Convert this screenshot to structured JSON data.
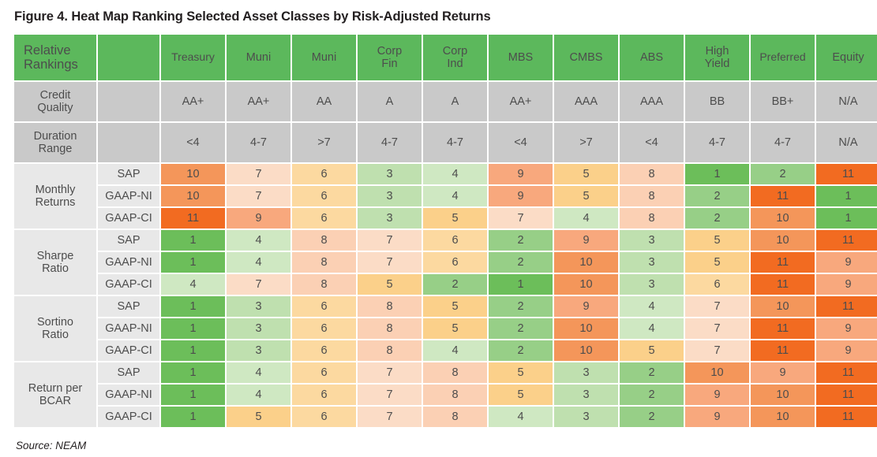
{
  "figure": {
    "title": "Figure 4. Heat Map Ranking Selected Asset Classes by Risk-Adjusted Returns",
    "source": "Source: NEAM"
  },
  "table": {
    "corner_label": "Relative\nRankings",
    "corner_label_line1": "Relative",
    "corner_label_line2": "Rankings",
    "blank_header": "",
    "asset_classes": [
      {
        "label": "Treasury",
        "line1": "Treasury",
        "line2": ""
      },
      {
        "label": "Muni",
        "line1": "Muni",
        "line2": ""
      },
      {
        "label": "Muni",
        "line1": "Muni",
        "line2": ""
      },
      {
        "label": "Corp Fin",
        "line1": "Corp",
        "line2": "Fin"
      },
      {
        "label": "Corp Ind",
        "line1": "Corp",
        "line2": "Ind"
      },
      {
        "label": "MBS",
        "line1": "MBS",
        "line2": ""
      },
      {
        "label": "CMBS",
        "line1": "CMBS",
        "line2": ""
      },
      {
        "label": "ABS",
        "line1": "ABS",
        "line2": ""
      },
      {
        "label": "High Yield",
        "line1": "High",
        "line2": "Yield"
      },
      {
        "label": "Preferred",
        "line1": "Preferred",
        "line2": ""
      },
      {
        "label": "Equity",
        "line1": "Equity",
        "line2": ""
      }
    ],
    "attribute_rows": [
      {
        "label_line1": "Credit",
        "label_line2": "Quality",
        "values": [
          "AA+",
          "AA+",
          "AA",
          "A",
          "A",
          "AA+",
          "AAA",
          "AAA",
          "BB",
          "BB+",
          "N/A"
        ]
      },
      {
        "label_line1": "Duration",
        "label_line2": "Range",
        "values": [
          "<4",
          "4-7",
          ">7",
          "4-7",
          "4-7",
          "<4",
          ">7",
          "<4",
          "4-7",
          "4-7",
          "N/A"
        ]
      }
    ],
    "metric_groups": [
      {
        "label_line1": "Monthly",
        "label_line2": "Returns",
        "rows": [
          {
            "basis": "SAP",
            "values": [
              10,
              7,
              6,
              3,
              4,
              9,
              5,
              8,
              1,
              2,
              11
            ]
          },
          {
            "basis": "GAAP-NI",
            "values": [
              10,
              7,
              6,
              3,
              4,
              9,
              5,
              8,
              2,
              11,
              1
            ]
          },
          {
            "basis": "GAAP-CI",
            "values": [
              11,
              9,
              6,
              3,
              5,
              7,
              4,
              8,
              2,
              10,
              1
            ]
          }
        ]
      },
      {
        "label_line1": "Sharpe",
        "label_line2": "Ratio",
        "rows": [
          {
            "basis": "SAP",
            "values": [
              1,
              4,
              8,
              7,
              6,
              2,
              9,
              3,
              5,
              10,
              11
            ]
          },
          {
            "basis": "GAAP-NI",
            "values": [
              1,
              4,
              8,
              7,
              6,
              2,
              10,
              3,
              5,
              11,
              9
            ]
          },
          {
            "basis": "GAAP-CI",
            "values": [
              4,
              7,
              8,
              5,
              2,
              1,
              10,
              3,
              6,
              11,
              9
            ]
          }
        ]
      },
      {
        "label_line1": "Sortino",
        "label_line2": "Ratio",
        "rows": [
          {
            "basis": "SAP",
            "values": [
              1,
              3,
              6,
              8,
              5,
              2,
              9,
              4,
              7,
              10,
              11
            ]
          },
          {
            "basis": "GAAP-NI",
            "values": [
              1,
              3,
              6,
              8,
              5,
              2,
              10,
              4,
              7,
              11,
              9
            ]
          },
          {
            "basis": "GAAP-CI",
            "values": [
              1,
              3,
              6,
              8,
              4,
              2,
              10,
              5,
              7,
              11,
              9
            ]
          }
        ]
      },
      {
        "label_line1": "Return per",
        "label_line2": "BCAR",
        "rows": [
          {
            "basis": "SAP",
            "values": [
              1,
              4,
              6,
              7,
              8,
              5,
              3,
              2,
              10,
              9,
              11
            ]
          },
          {
            "basis": "GAAP-NI",
            "values": [
              1,
              4,
              6,
              7,
              8,
              5,
              3,
              2,
              9,
              10,
              11
            ]
          },
          {
            "basis": "GAAP-CI",
            "values": [
              1,
              5,
              6,
              7,
              8,
              4,
              3,
              2,
              9,
              10,
              11
            ]
          }
        ]
      }
    ]
  },
  "colors": {
    "header_green": "#5cb85c",
    "attr_gray": "#c9c9c9",
    "label_gray": "#e8e8e8",
    "text_gray": "#4d4d4d",
    "scale": {
      "1": "#6cbe5a",
      "2": "#97cf87",
      "3": "#bfe0af",
      "4": "#cfe8c2",
      "5": "#fbd08a",
      "6": "#fcd9a0",
      "7": "#fbdcc6",
      "8": "#fbd0b4",
      "9": "#f8a87d",
      "10": "#f4965a",
      "11": "#f26b21"
    }
  },
  "chart_data": {
    "type": "heatmap",
    "title": "Figure 4. Heat Map Ranking Selected Asset Classes by Risk-Adjusted Returns",
    "xlabel": "",
    "ylabel": "",
    "legend": "",
    "categories": [
      "Treasury",
      "Muni",
      "Muni",
      "Corp Fin",
      "Corp Ind",
      "MBS",
      "CMBS",
      "ABS",
      "High Yield",
      "Preferred",
      "Equity"
    ],
    "value_range": [
      1,
      11
    ],
    "value_meaning": "Relative rank, 1 = best (green), 11 = worst (orange)",
    "rows": [
      {
        "group": "Monthly Returns",
        "basis": "SAP",
        "values": [
          10,
          7,
          6,
          3,
          4,
          9,
          5,
          8,
          1,
          2,
          11
        ]
      },
      {
        "group": "Monthly Returns",
        "basis": "GAAP-NI",
        "values": [
          10,
          7,
          6,
          3,
          4,
          9,
          5,
          8,
          2,
          11,
          1
        ]
      },
      {
        "group": "Monthly Returns",
        "basis": "GAAP-CI",
        "values": [
          11,
          9,
          6,
          3,
          5,
          7,
          4,
          8,
          2,
          10,
          1
        ]
      },
      {
        "group": "Sharpe Ratio",
        "basis": "SAP",
        "values": [
          1,
          4,
          8,
          7,
          6,
          2,
          9,
          3,
          5,
          10,
          11
        ]
      },
      {
        "group": "Sharpe Ratio",
        "basis": "GAAP-NI",
        "values": [
          1,
          4,
          8,
          7,
          6,
          2,
          10,
          3,
          5,
          11,
          9
        ]
      },
      {
        "group": "Sharpe Ratio",
        "basis": "GAAP-CI",
        "values": [
          4,
          7,
          8,
          5,
          2,
          1,
          10,
          3,
          6,
          11,
          9
        ]
      },
      {
        "group": "Sortino Ratio",
        "basis": "SAP",
        "values": [
          1,
          3,
          6,
          8,
          5,
          2,
          9,
          4,
          7,
          10,
          11
        ]
      },
      {
        "group": "Sortino Ratio",
        "basis": "GAAP-NI",
        "values": [
          1,
          3,
          6,
          8,
          5,
          2,
          10,
          4,
          7,
          11,
          9
        ]
      },
      {
        "group": "Sortino Ratio",
        "basis": "GAAP-CI",
        "values": [
          1,
          3,
          6,
          8,
          4,
          2,
          10,
          5,
          7,
          11,
          9
        ]
      },
      {
        "group": "Return per BCAR",
        "basis": "SAP",
        "values": [
          1,
          4,
          6,
          7,
          8,
          5,
          3,
          2,
          10,
          9,
          11
        ]
      },
      {
        "group": "Return per BCAR",
        "basis": "GAAP-NI",
        "values": [
          1,
          4,
          6,
          7,
          8,
          5,
          3,
          2,
          9,
          10,
          11
        ]
      },
      {
        "group": "Return per BCAR",
        "basis": "GAAP-CI",
        "values": [
          1,
          5,
          6,
          7,
          8,
          4,
          3,
          2,
          9,
          10,
          11
        ]
      }
    ],
    "credit_quality": [
      "AA+",
      "AA+",
      "AA",
      "A",
      "A",
      "AA+",
      "AAA",
      "AAA",
      "BB",
      "BB+",
      "N/A"
    ],
    "duration_range": [
      "<4",
      "4-7",
      ">7",
      "4-7",
      "4-7",
      "<4",
      ">7",
      "<4",
      "4-7",
      "4-7",
      "N/A"
    ]
  }
}
